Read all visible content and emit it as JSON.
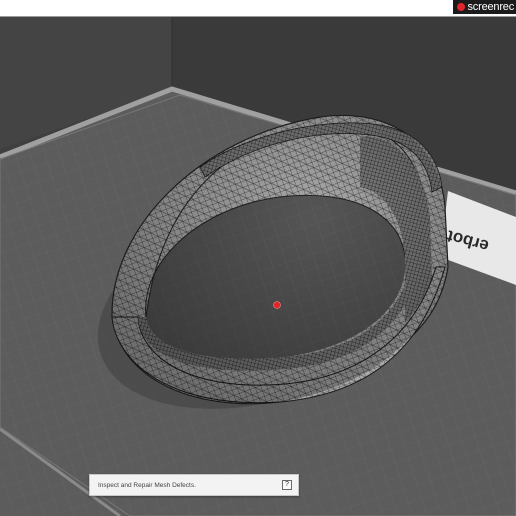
{
  "recorder": {
    "label": "screenrec",
    "dot_color": "#e0262b"
  },
  "bed": {
    "logo_text": "erbot",
    "logo_prefix_char": "ı"
  },
  "tooltip": {
    "text": "Inspect and Repair Mesh Defects.",
    "help_label": "?"
  },
  "colors": {
    "background": "#3f3f3f",
    "bed": "#5a5a5a",
    "bed_edge": "#9a9a9a",
    "mesh_light": "#bdbdbd",
    "mesh_dark": "#2b2b2b",
    "center_marker": "#e0262b"
  }
}
